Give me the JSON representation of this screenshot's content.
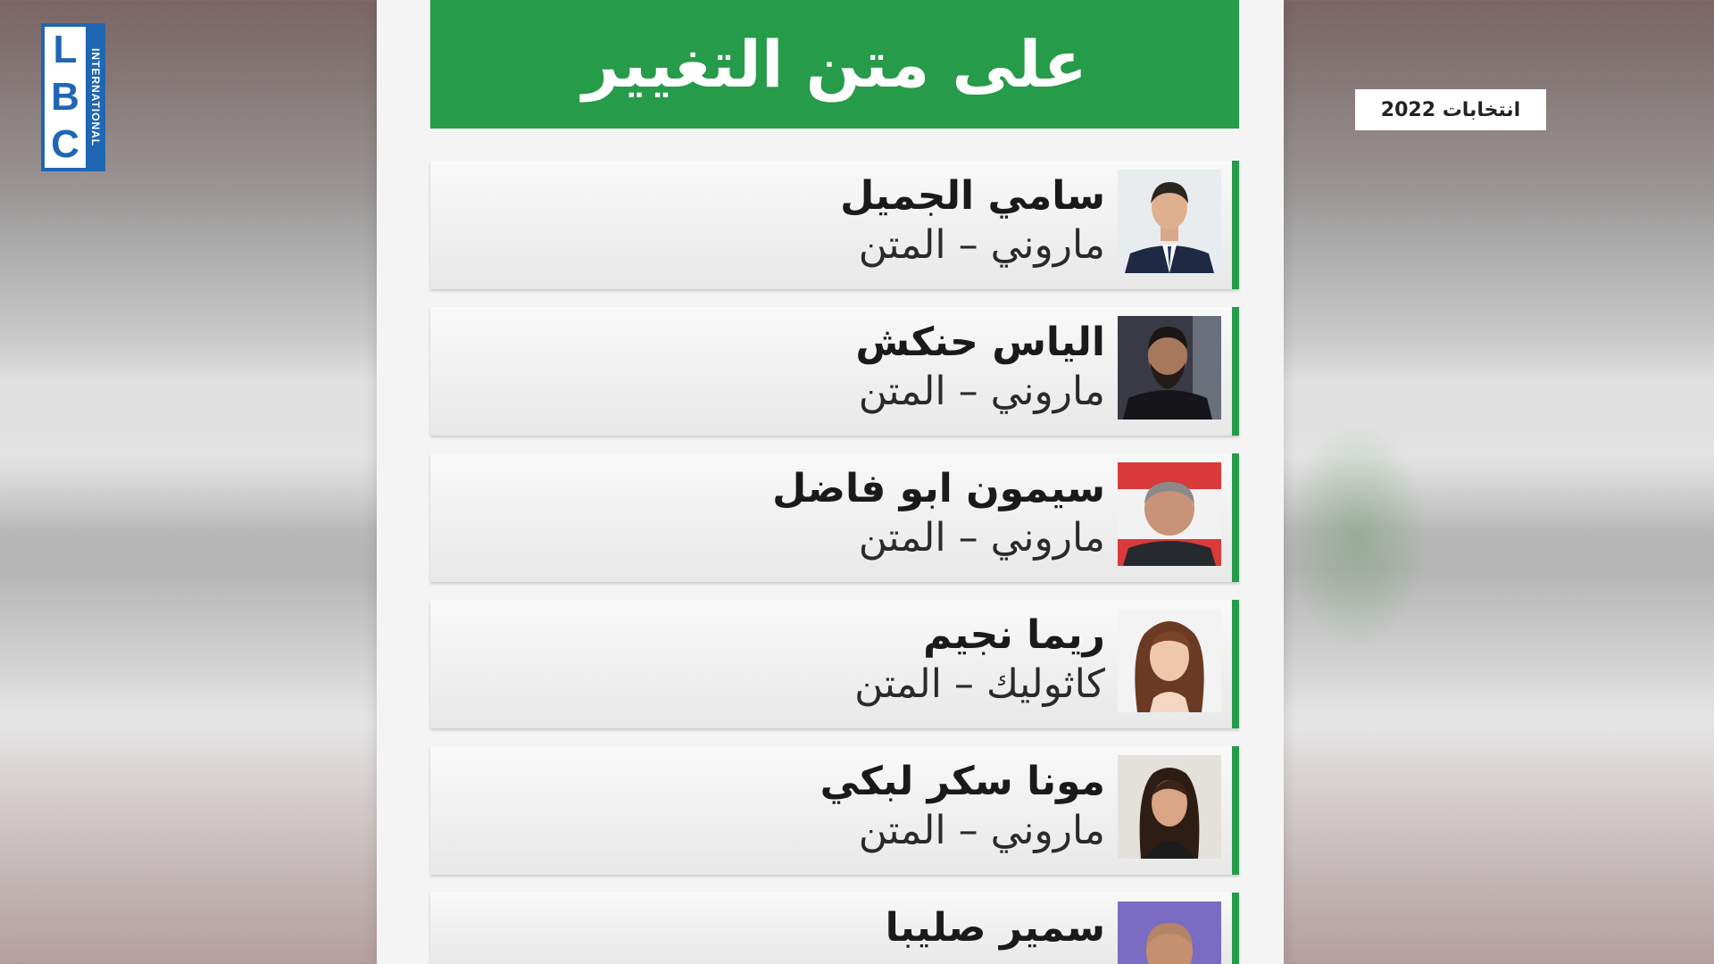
{
  "logo": {
    "letters": [
      "L",
      "B",
      "C"
    ],
    "subtext": "INTERNATIONAL",
    "color": "#1f66b3"
  },
  "badge": {
    "text": "انتخابات 2022"
  },
  "header": {
    "title": "على متن التغيير",
    "color": "#269b4a"
  },
  "candidates": [
    {
      "name": "سامي الجميل",
      "detail": "ماروني – المتن"
    },
    {
      "name": "الياس حنكش",
      "detail": "ماروني – المتن"
    },
    {
      "name": "سيمون ابو فاضل",
      "detail": "ماروني – المتن"
    },
    {
      "name": "ريما نجيم",
      "detail": "كاثوليك – المتن"
    },
    {
      "name": "مونا سكر لبكي",
      "detail": "ماروني – المتن"
    },
    {
      "name": "سمير صليبا",
      "detail": ""
    }
  ]
}
